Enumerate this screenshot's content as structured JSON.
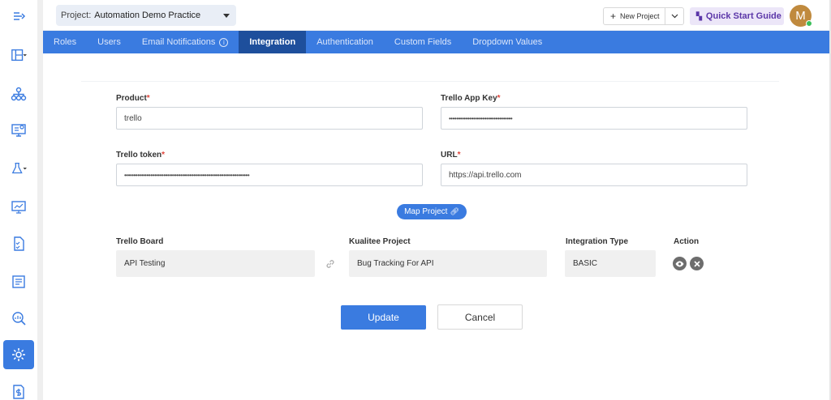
{
  "header": {
    "project_label": "Project:",
    "project_value": "Automation Demo Practice",
    "new_project": "New Project",
    "quick_start": "Quick Start Guide",
    "avatar_initial": "M"
  },
  "tabs": [
    "Roles",
    "Users",
    "Email Notifications",
    "Integration",
    "Authentication",
    "Custom Fields",
    "Dropdown Values"
  ],
  "active_tab": "Integration",
  "sidebar": {
    "icons": [
      "menu-collapse-icon",
      "dashboard-icon",
      "hierarchy-icon",
      "monitor-settings-icon",
      "flask-icon",
      "monitor-chart-icon",
      "checklist-icon",
      "report-icon",
      "search-chart-icon",
      "gear-icon",
      "dollar-doc-icon"
    ],
    "active": "gear-icon"
  },
  "form": {
    "product_label": "Product",
    "product_value": "trello",
    "app_key_label": "Trello App Key",
    "app_key_value": "••••••••••••••••••••••••••••••••••",
    "token_label": "Trello token",
    "token_value": "•••••••••••••••••••••••••••••••••••••••••••••••••••••••••••••••••••",
    "url_label": "URL",
    "url_value": "https://api.trello.com",
    "required_mark": "*"
  },
  "map_project": "Map Project",
  "mapping": {
    "headers": {
      "board": "Trello Board",
      "project": "Kualitee Project",
      "type": "Integration Type",
      "action": "Action"
    },
    "row": {
      "board": "API Testing",
      "project": "Bug Tracking For API",
      "type": "BASIC"
    }
  },
  "buttons": {
    "update": "Update",
    "cancel": "Cancel"
  },
  "colors": {
    "primary": "#3a7be0",
    "active_tab": "#1e4f9c",
    "required": "#e0443a",
    "quick_start_bg": "#ece6f8"
  }
}
